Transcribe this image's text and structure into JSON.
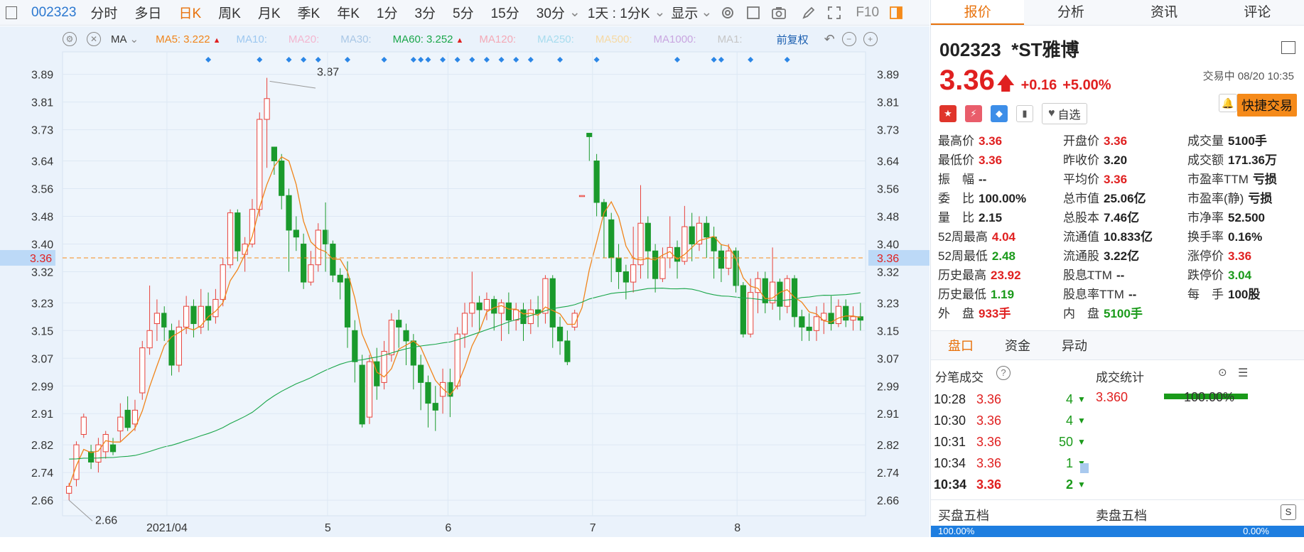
{
  "toolbar": {
    "code": "002323",
    "periods": [
      "分时",
      "多日",
      "日K",
      "周K",
      "月K",
      "季K",
      "年K",
      "1分",
      "3分",
      "5分",
      "15分",
      "30分"
    ],
    "active_period": "日K",
    "period_dropdown": "1天 : 1分K",
    "display": "显示",
    "f10": "F10"
  },
  "ma_bar": {
    "ma": "MA",
    "items": [
      {
        "label": "MA5:",
        "value": "3.222",
        "color": "#f0841a",
        "arrow": "▲"
      },
      {
        "label": "MA10:",
        "value": "",
        "color": "#9dc8f0",
        "arrow": ""
      },
      {
        "label": "MA20:",
        "value": "",
        "color": "#f3b6cf",
        "arrow": ""
      },
      {
        "label": "MA30:",
        "value": "",
        "color": "#a9c7e6",
        "arrow": ""
      },
      {
        "label": "MA60:",
        "value": "3.252",
        "color": "#1aa64a",
        "arrow": "▲"
      },
      {
        "label": "MA120:",
        "value": "",
        "color": "#f4a9b6",
        "arrow": ""
      },
      {
        "label": "MA250:",
        "value": "",
        "color": "#a7dcee",
        "arrow": ""
      },
      {
        "label": "MA500:",
        "value": "",
        "color": "#f6d9a3",
        "arrow": ""
      },
      {
        "label": "MA1000:",
        "value": "",
        "color": "#c9a6e0",
        "arrow": ""
      },
      {
        "label": "MA1:",
        "value": "",
        "color": "#c6c6c6",
        "arrow": ""
      }
    ],
    "adjust": "前复权"
  },
  "chart_data": {
    "type": "candlestick",
    "y_ticks": [
      "3.89",
      "3.81",
      "3.73",
      "3.64",
      "3.56",
      "3.48",
      "3.40",
      "3.32",
      "3.23",
      "3.15",
      "3.07",
      "2.99",
      "2.91",
      "2.82",
      "2.74",
      "2.66"
    ],
    "current_price": "3.36",
    "high_marker": "3.87",
    "low_marker": "2.66",
    "x_labels": [
      "2021/04",
      "5",
      "6",
      "7",
      "8"
    ],
    "candles": [
      [
        2.68,
        2.7,
        2.66,
        2.71
      ],
      [
        2.72,
        2.82,
        2.7,
        2.83
      ],
      [
        2.85,
        2.9,
        2.84,
        2.91
      ],
      [
        2.8,
        2.77,
        2.75,
        2.82
      ],
      [
        2.77,
        2.82,
        2.74,
        2.84
      ],
      [
        2.8,
        2.85,
        2.78,
        2.86
      ],
      [
        2.82,
        2.8,
        2.79,
        2.84
      ],
      [
        2.86,
        2.9,
        2.83,
        2.94
      ],
      [
        2.92,
        2.87,
        2.86,
        2.96
      ],
      [
        2.88,
        2.92,
        2.86,
        2.95
      ],
      [
        2.97,
        3.1,
        2.95,
        3.12
      ],
      [
        3.1,
        3.15,
        3.08,
        3.28
      ],
      [
        3.17,
        3.2,
        3.12,
        3.24
      ],
      [
        3.2,
        3.16,
        3.12,
        3.22
      ],
      [
        3.15,
        3.05,
        3.02,
        3.17
      ],
      [
        3.05,
        3.16,
        3.03,
        3.18
      ],
      [
        3.16,
        3.22,
        3.14,
        3.25
      ],
      [
        3.22,
        3.17,
        3.13,
        3.24
      ],
      [
        3.16,
        3.22,
        3.14,
        3.27
      ],
      [
        3.22,
        3.18,
        3.15,
        3.26
      ],
      [
        3.19,
        3.24,
        3.17,
        3.27
      ],
      [
        3.24,
        3.34,
        3.22,
        3.36
      ],
      [
        3.34,
        3.49,
        3.33,
        3.5
      ],
      [
        3.49,
        3.38,
        3.35,
        3.5
      ],
      [
        3.37,
        3.4,
        3.32,
        3.42
      ],
      [
        3.4,
        3.5,
        3.39,
        3.53
      ],
      [
        3.5,
        3.76,
        3.48,
        3.78
      ],
      [
        3.76,
        3.82,
        3.62,
        3.88
      ],
      [
        3.68,
        3.64,
        3.6,
        3.68
      ],
      [
        3.64,
        3.54,
        3.5,
        3.66
      ],
      [
        3.54,
        3.44,
        3.32,
        3.56
      ],
      [
        3.44,
        3.42,
        3.38,
        3.48
      ],
      [
        3.4,
        3.29,
        3.27,
        3.43
      ],
      [
        3.29,
        3.34,
        3.28,
        3.38
      ],
      [
        3.34,
        3.44,
        3.32,
        3.46
      ],
      [
        3.44,
        3.4,
        3.32,
        3.52
      ],
      [
        3.4,
        3.31,
        3.29,
        3.41
      ],
      [
        3.31,
        3.29,
        3.24,
        3.33
      ],
      [
        3.3,
        3.16,
        3.1,
        3.35
      ],
      [
        3.15,
        3.06,
        3.0,
        3.18
      ],
      [
        3.05,
        2.88,
        2.87,
        3.08
      ],
      [
        2.9,
        3.06,
        2.88,
        3.08
      ],
      [
        3.06,
        2.99,
        2.95,
        3.1
      ],
      [
        3.0,
        3.09,
        2.98,
        3.12
      ],
      [
        3.08,
        3.18,
        3.06,
        3.2
      ],
      [
        3.18,
        3.16,
        3.1,
        3.21
      ],
      [
        3.15,
        3.12,
        3.05,
        3.17
      ],
      [
        3.12,
        3.05,
        2.98,
        3.14
      ],
      [
        3.05,
        3.0,
        2.92,
        3.08
      ],
      [
        3.0,
        2.94,
        2.87,
        3.02
      ],
      [
        2.94,
        2.92,
        2.86,
        2.99
      ],
      [
        2.96,
        3.0,
        2.91,
        3.04
      ],
      [
        3.0,
        2.96,
        2.9,
        3.04
      ],
      [
        2.99,
        3.14,
        2.98,
        3.16
      ],
      [
        3.14,
        3.2,
        3.1,
        3.23
      ],
      [
        3.2,
        3.23,
        3.16,
        3.32
      ],
      [
        3.23,
        3.21,
        3.15,
        3.25
      ],
      [
        3.21,
        3.24,
        3.18,
        3.26
      ],
      [
        3.24,
        3.2,
        3.15,
        3.25
      ],
      [
        3.2,
        3.23,
        3.12,
        3.24
      ],
      [
        3.23,
        3.18,
        3.14,
        3.26
      ],
      [
        3.18,
        3.21,
        3.15,
        3.23
      ],
      [
        3.21,
        3.17,
        3.12,
        3.23
      ],
      [
        3.17,
        3.21,
        3.14,
        3.24
      ],
      [
        3.21,
        3.2,
        3.16,
        3.25
      ],
      [
        3.2,
        3.3,
        3.17,
        3.31
      ],
      [
        3.3,
        3.16,
        3.1,
        3.31
      ],
      [
        3.16,
        3.12,
        3.08,
        3.19
      ],
      [
        3.12,
        3.06,
        3.05,
        3.15
      ],
      [
        3.16,
        3.2,
        3.15,
        3.21
      ],
      [
        3.54,
        3.54,
        3.54,
        3.54
      ],
      [
        3.72,
        3.71,
        3.64,
        3.72
      ],
      [
        3.64,
        3.52,
        3.48,
        3.66
      ],
      [
        3.52,
        3.48,
        3.36,
        3.53
      ],
      [
        3.47,
        3.36,
        3.29,
        3.49
      ],
      [
        3.36,
        3.32,
        3.27,
        3.4
      ],
      [
        3.32,
        3.29,
        3.24,
        3.34
      ],
      [
        3.29,
        3.34,
        3.26,
        3.45
      ],
      [
        3.34,
        3.46,
        3.3,
        3.57
      ],
      [
        3.46,
        3.38,
        3.3,
        3.48
      ],
      [
        3.38,
        3.3,
        3.26,
        3.4
      ],
      [
        3.3,
        3.36,
        3.29,
        3.39
      ],
      [
        3.36,
        3.39,
        3.33,
        3.48
      ],
      [
        3.39,
        3.35,
        3.3,
        3.41
      ],
      [
        3.35,
        3.45,
        3.34,
        3.51
      ],
      [
        3.45,
        3.4,
        3.35,
        3.49
      ],
      [
        3.4,
        3.46,
        3.38,
        3.48
      ],
      [
        3.46,
        3.42,
        3.36,
        3.48
      ],
      [
        3.42,
        3.38,
        3.3,
        3.45
      ],
      [
        3.38,
        3.33,
        3.29,
        3.4
      ],
      [
        3.33,
        3.38,
        3.31,
        3.4
      ],
      [
        3.38,
        3.28,
        3.26,
        3.39
      ],
      [
        3.28,
        3.14,
        3.13,
        3.29
      ],
      [
        3.14,
        3.26,
        3.13,
        3.3
      ],
      [
        3.26,
        3.3,
        3.2,
        3.32
      ],
      [
        3.3,
        3.23,
        3.2,
        3.32
      ],
      [
        3.23,
        3.29,
        3.21,
        3.39
      ],
      [
        3.29,
        3.22,
        3.18,
        3.3
      ],
      [
        3.22,
        3.3,
        3.2,
        3.31
      ],
      [
        3.3,
        3.19,
        3.16,
        3.31
      ],
      [
        3.19,
        3.16,
        3.12,
        3.21
      ],
      [
        3.16,
        3.15,
        3.12,
        3.2
      ],
      [
        3.15,
        3.19,
        3.12,
        3.22
      ],
      [
        3.18,
        3.2,
        3.14,
        3.23
      ],
      [
        3.2,
        3.17,
        3.15,
        3.25
      ],
      [
        3.17,
        3.22,
        3.16,
        3.24
      ],
      [
        3.22,
        3.18,
        3.16,
        3.24
      ],
      [
        3.18,
        3.19,
        3.15,
        3.22
      ],
      [
        3.19,
        3.18,
        3.15,
        3.23
      ]
    ]
  },
  "right": {
    "tabs": [
      "报价",
      "分析",
      "资讯",
      "评论"
    ],
    "code": "002323",
    "name": "*ST雅博",
    "price": "3.36",
    "change": "+0.16",
    "pct": "+5.00%",
    "status": "交易中 08/20 10:35",
    "fav": "自选",
    "quick_trade": "快捷交易",
    "stats": [
      {
        "label": "最高价",
        "value": "3.36",
        "cls": "red"
      },
      {
        "label": "开盘价",
        "value": "3.36",
        "cls": "red"
      },
      {
        "label": "成交量",
        "value": "5100手",
        "cls": "dark"
      },
      {
        "label": "最低价",
        "value": "3.36",
        "cls": "red"
      },
      {
        "label": "昨收价",
        "value": "3.20",
        "cls": "dark"
      },
      {
        "label": "成交额",
        "value": "171.36万",
        "cls": "dark"
      },
      {
        "label": "振　幅",
        "value": "--",
        "cls": "dark"
      },
      {
        "label": "平均价",
        "value": "3.36",
        "cls": "red"
      },
      {
        "label": "市盈率TTM",
        "value": "亏损",
        "cls": "dark"
      },
      {
        "label": "委　比",
        "value": "100.00%",
        "cls": "dark"
      },
      {
        "label": "总市值",
        "value": "25.06亿",
        "cls": "dark"
      },
      {
        "label": "市盈率(静)",
        "value": "亏损",
        "cls": "dark"
      },
      {
        "label": "量　比",
        "value": "2.15",
        "cls": "dark"
      },
      {
        "label": "总股本",
        "value": "7.46亿",
        "cls": "dark"
      },
      {
        "label": "市净率",
        "value": "52.500",
        "cls": "dark"
      },
      {
        "label": "52周最高",
        "value": "4.04",
        "cls": "red"
      },
      {
        "label": "流通值",
        "value": "10.833亿",
        "cls": "dark"
      },
      {
        "label": "换手率",
        "value": "0.16%",
        "cls": "dark"
      },
      {
        "label": "52周最低",
        "value": "2.48",
        "cls": "green"
      },
      {
        "label": "流通股",
        "value": "3.22亿",
        "cls": "dark"
      },
      {
        "label": "涨停价",
        "value": "3.36",
        "cls": "red"
      },
      {
        "label": "历史最高",
        "value": "23.92",
        "cls": "red"
      },
      {
        "label": "股息TTM",
        "value": "--",
        "cls": "dark"
      },
      {
        "label": "跌停价",
        "value": "3.04",
        "cls": "green"
      },
      {
        "label": "历史最低",
        "value": "1.19",
        "cls": "green"
      },
      {
        "label": "股息率TTM",
        "value": "--",
        "cls": "dark"
      },
      {
        "label": "每　手",
        "value": "100股",
        "cls": "dark"
      },
      {
        "label": "外　盘",
        "value": "933手",
        "cls": "red"
      },
      {
        "label": "内　盘",
        "value": "5100手",
        "cls": "green"
      }
    ],
    "subtabs": [
      "盘口",
      "资金",
      "异动"
    ],
    "trades_title": "分笔成交",
    "stats_title": "成交统计",
    "trades": [
      {
        "time": "10:28",
        "price": "3.36",
        "vol": "4"
      },
      {
        "time": "10:30",
        "price": "3.36",
        "vol": "4"
      },
      {
        "time": "10:31",
        "price": "3.36",
        "vol": "50"
      },
      {
        "time": "10:34",
        "price": "3.36",
        "vol": "1"
      },
      {
        "time": "10:34",
        "price": "3.36",
        "vol": "2"
      }
    ],
    "stat_price": "3.360",
    "stat_pct": "100.00%",
    "buy_title": "买盘五档",
    "sell_title": "卖盘五档",
    "buy_pct": "100.00%",
    "sell_pct": "0.00%"
  }
}
